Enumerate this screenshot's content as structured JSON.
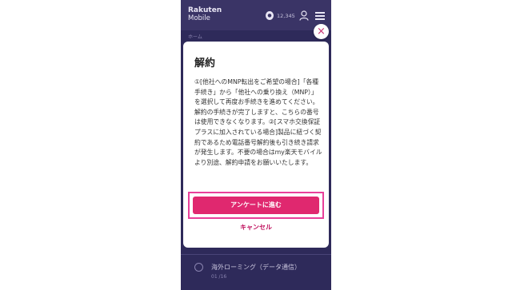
{
  "header": {
    "logo_line1": "Rakuten",
    "logo_line2": "Mobile",
    "points": "12,345"
  },
  "breadcrumb": "ホーム",
  "bottom_item": {
    "title": "海外ローミング（データ通信）",
    "subtitle": "01 /16"
  },
  "modal": {
    "title": "解約",
    "body": "①[他社へのMNP転出をご希望の場合]「各種手続き」から「他社への乗り換え（MNP）」を選択して再度お手続きを進めてください。解約の手続きが完了しますと、こちらの番号は使用できなくなります。②[スマホ交換保証プラスに加入されている場合]製品に紐づく契約であるため電話番号解約後も引き続き請求が発生します。不要の場合はmy楽天モバイルより別途、解約申請をお願いいたします。",
    "primary_button": "アンケートに進む",
    "cancel_link": "キャンセル",
    "close_symbol": "×"
  },
  "colors": {
    "background_overlay": "#2e2a5a",
    "accent": "#e0286f",
    "highlight_outline": "#e8409a",
    "cancel_text": "#c0135f"
  }
}
